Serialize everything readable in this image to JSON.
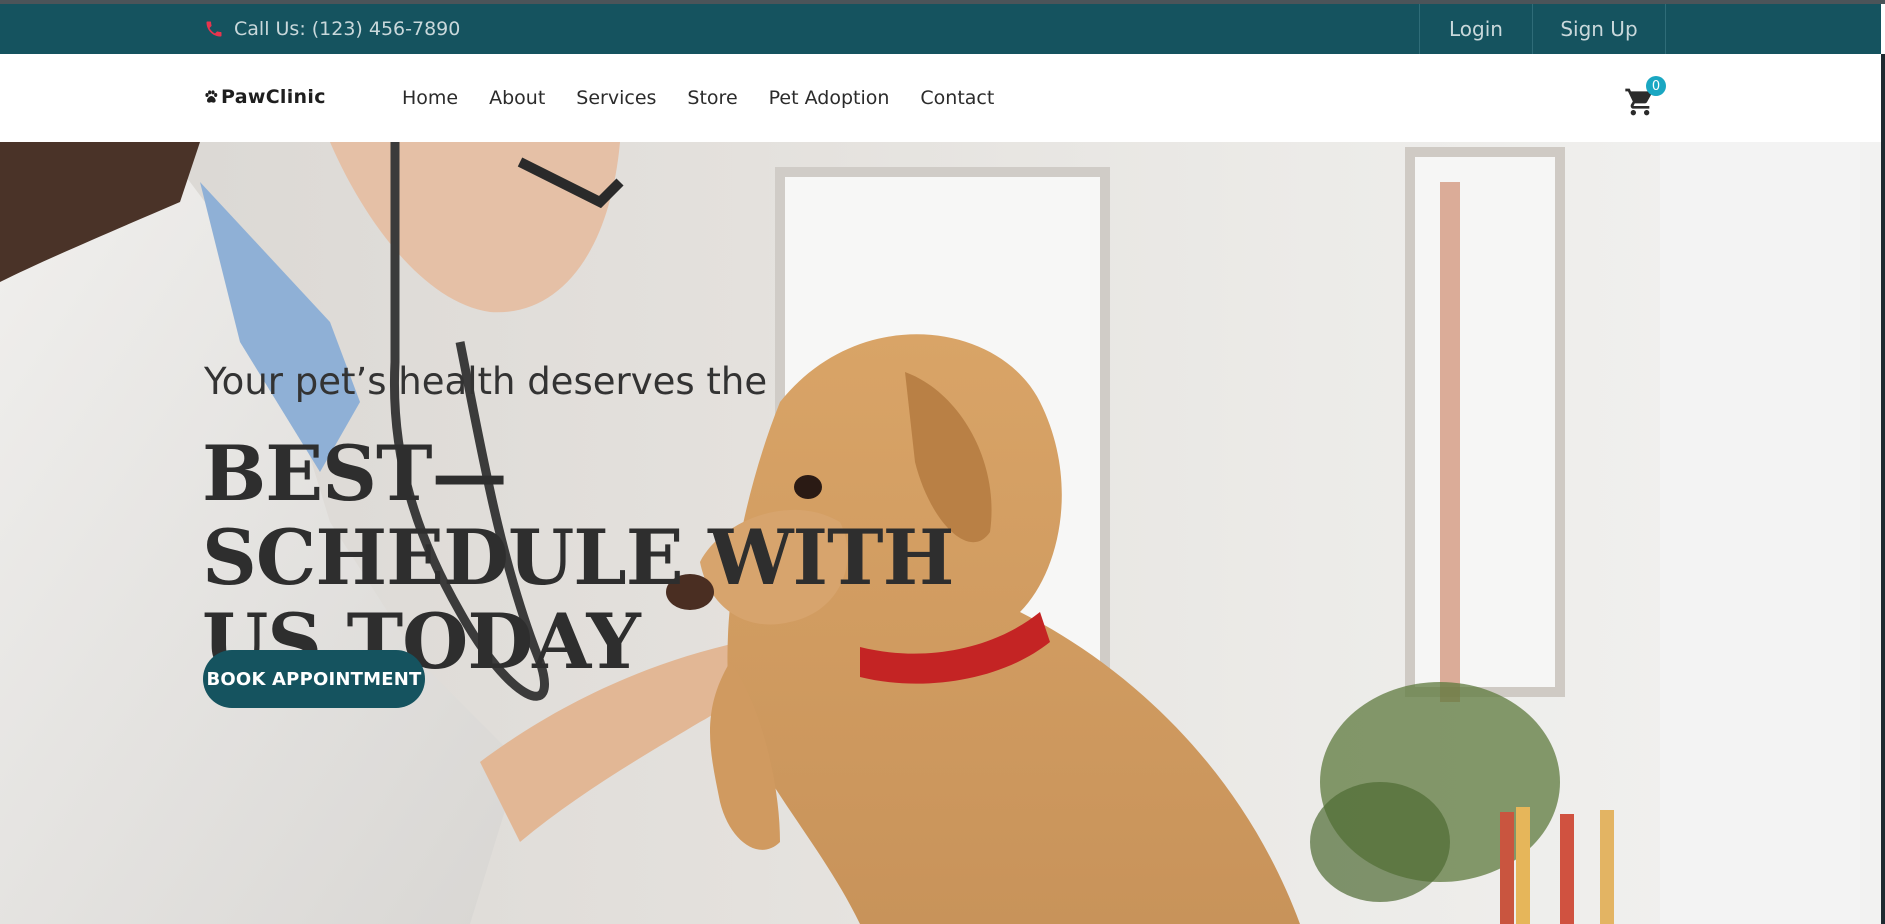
{
  "topbar": {
    "call_label": "Call Us: (123) 456-7890",
    "login_label": "Login",
    "signup_label": "Sign Up",
    "background_color": "#15535f",
    "phone_icon_color": "#e8344e"
  },
  "nav": {
    "logo_text": "PawClinic",
    "items": [
      {
        "label": "Home"
      },
      {
        "label": "About"
      },
      {
        "label": "Services"
      },
      {
        "label": "Store"
      },
      {
        "label": "Pet Adoption"
      },
      {
        "label": "Contact"
      }
    ],
    "cart_count": "0",
    "cart_badge_color": "#1aa7c2"
  },
  "hero": {
    "subtitle": "Your pet’s health deserves the",
    "title": "BEST—SCHEDULE WITH US TODAY",
    "cta_label": "BOOK APPOINTMENT",
    "cta_color": "#15535f"
  },
  "icons": {
    "phone": "phone-icon",
    "logo": "paw-icon",
    "cart": "cart-icon"
  }
}
